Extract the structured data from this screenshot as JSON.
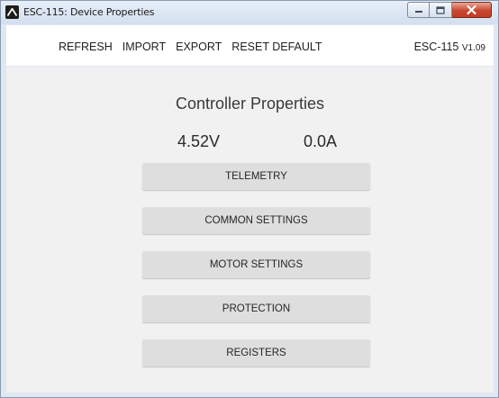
{
  "window": {
    "title": "ESC-115: Device Properties"
  },
  "menu": {
    "items": [
      "REFRESH",
      "IMPORT",
      "EXPORT",
      "RESET DEFAULT"
    ],
    "device": "ESC-115",
    "version": "V1.09"
  },
  "main": {
    "heading": "Controller Properties",
    "voltage": "4.52V",
    "current": "0.0A",
    "buttons": [
      "TELEMETRY",
      "COMMON SETTINGS",
      "MOTOR SETTINGS",
      "PROTECTION",
      "REGISTERS"
    ]
  },
  "icons": {
    "app": "logo-icon",
    "minimize": "minimize-icon",
    "maximize": "maximize-icon",
    "close": "close-icon"
  },
  "colors": {
    "close_button": "#c8482f",
    "content_bg": "#f1f1f1",
    "button_bg": "#dedede"
  }
}
